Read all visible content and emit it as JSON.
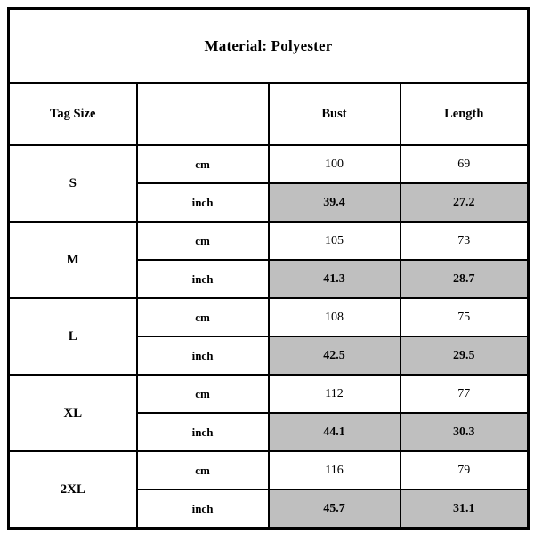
{
  "title": "Material: Polyester",
  "headers": {
    "tag_size": "Tag Size",
    "unit": "",
    "bust": "Bust",
    "length": "Length"
  },
  "units": {
    "cm": "cm",
    "inch": "inch"
  },
  "colors": {
    "border": "#000000",
    "shaded_row": "#bfbfbf",
    "background": "#ffffff",
    "text": "#000000"
  },
  "rows": [
    {
      "size": "S",
      "cm": {
        "unit": "cm",
        "bust": "100",
        "length": "69"
      },
      "inch": {
        "unit": "inch",
        "bust": "39.4",
        "length": "27.2"
      }
    },
    {
      "size": "M",
      "cm": {
        "unit": "cm",
        "bust": "105",
        "length": "73"
      },
      "inch": {
        "unit": "inch",
        "bust": "41.3",
        "length": "28.7"
      }
    },
    {
      "size": "L",
      "cm": {
        "unit": "cm",
        "bust": "108",
        "length": "75"
      },
      "inch": {
        "unit": "inch",
        "bust": "42.5",
        "length": "29.5"
      }
    },
    {
      "size": "XL",
      "cm": {
        "unit": "cm",
        "bust": "112",
        "length": "77"
      },
      "inch": {
        "unit": "inch",
        "bust": "44.1",
        "length": "30.3"
      }
    },
    {
      "size": "2XL",
      "cm": {
        "unit": "cm",
        "bust": "116",
        "length": "79"
      },
      "inch": {
        "unit": "inch",
        "bust": "45.7",
        "length": "31.1"
      }
    }
  ]
}
